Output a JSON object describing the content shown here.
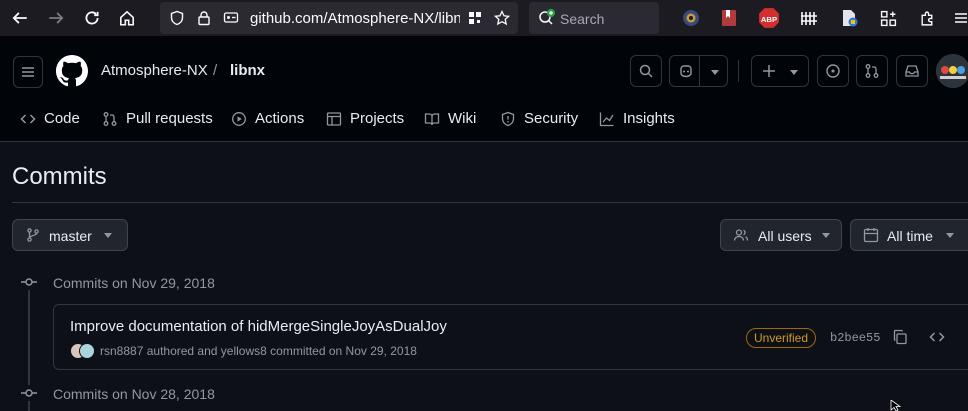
{
  "browser": {
    "url_main": "github.com/Atmosphere-NX/libn",
    "url_fade": "x",
    "search_placeholder": "Search",
    "abp_label": "ABP"
  },
  "header": {
    "owner": "Atmosphere-NX",
    "separator": "/",
    "repo": "libnx"
  },
  "tabs": [
    {
      "label": "Code",
      "icon": "code-icon"
    },
    {
      "label": "Pull requests",
      "icon": "pull-request-icon"
    },
    {
      "label": "Actions",
      "icon": "play-icon"
    },
    {
      "label": "Projects",
      "icon": "table-icon"
    },
    {
      "label": "Wiki",
      "icon": "book-icon"
    },
    {
      "label": "Security",
      "icon": "shield-icon"
    },
    {
      "label": "Insights",
      "icon": "graph-icon"
    }
  ],
  "page": {
    "title": "Commits",
    "branch": "master",
    "users_filter": "All users",
    "time_filter": "All time"
  },
  "groups": [
    {
      "label": "Commits on Nov 29, 2018",
      "commits": [
        {
          "title": "Improve documentation of hidMergeSingleJoyAsDualJoy",
          "author": "rsn8887",
          "authored_text": "authored and",
          "committer": "yellows8",
          "committed_text": "committed on Nov 29, 2018",
          "badge": "Unverified",
          "sha": "b2bee55"
        }
      ]
    },
    {
      "label": "Commits on Nov 28, 2018",
      "commits": []
    }
  ],
  "colors": {
    "page_bg": "#0d1117",
    "header_bg": "#010409",
    "border": "#30363d",
    "text": "#e6edf3",
    "muted": "#9198a1",
    "unverified": "#d29922"
  }
}
